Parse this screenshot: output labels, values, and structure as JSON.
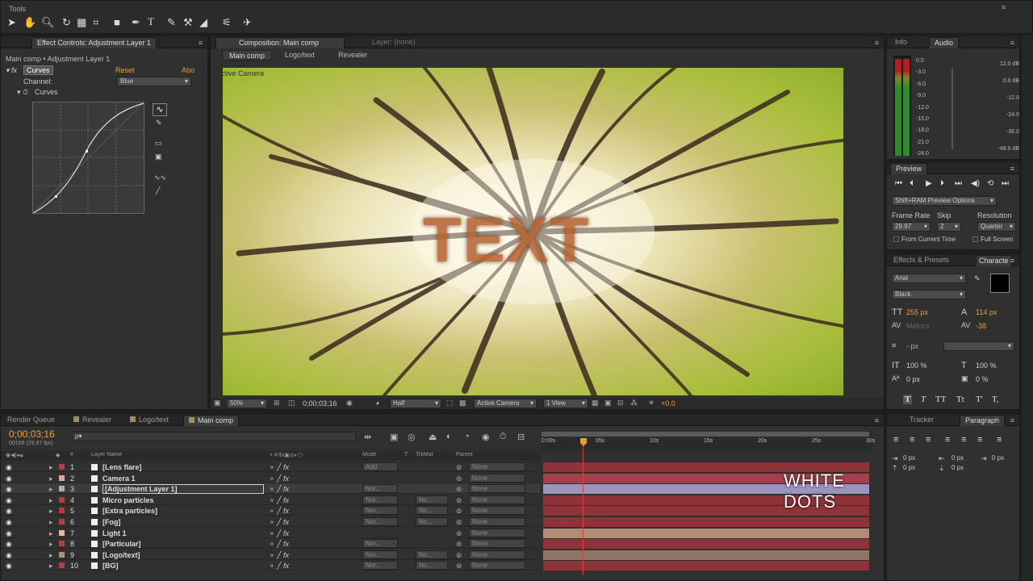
{
  "tools": {
    "title": "Tools"
  },
  "effect_controls": {
    "tab": "Effect Controls: Adjustment Layer 1",
    "breadcrumb": "Main comp • Adjustment Layer 1",
    "effect_name": "Curves",
    "reset": "Reset",
    "about": "Abo",
    "channel_label": "Channel:",
    "channel_value": "Blue",
    "curves_label": "Curves"
  },
  "composition": {
    "tab": "Composition: Main comp",
    "layer_tab": "Layer: (none)",
    "flow": [
      "Main comp",
      "Logo/text",
      "Revealer"
    ],
    "camera_label": "Active Camera",
    "text_overlay": "TEXT",
    "footer": {
      "zoom": "50%",
      "time": "0;00;03;16",
      "resolution": "Half",
      "camera": "Active Camera",
      "views": "1 View",
      "exposure": "+0.0"
    }
  },
  "info_audio": {
    "tab_info": "Info",
    "tab_audio": "Audio",
    "left_scale": [
      "0.0",
      "-3.0",
      "-6.0",
      "-9.0",
      "-12.0",
      "-15.0",
      "-18.0",
      "-21.0",
      "-24.0"
    ],
    "right_scale": [
      "12.0 dB",
      "0.0 dB",
      "-12.0",
      "-24.0",
      "-36.0",
      "-48.0 dB"
    ]
  },
  "preview": {
    "tab": "Preview",
    "ram_options": "Shift+RAM Preview Options",
    "frame_rate_label": "Frame Rate",
    "skip_label": "Skip",
    "resolution_label": "Resolution",
    "frame_rate": "29.97",
    "skip": "2",
    "resolution": "Quarter",
    "from_current": "From Current Time",
    "full_screen": "Full Screen"
  },
  "character": {
    "tab_effects": "Effects & Presets",
    "tab_character": "Characte",
    "font": "Arial",
    "style": "Black",
    "size": "255 px",
    "leading": "114 px",
    "kerning": "Metrics",
    "tracking": "-38",
    "stroke": "- px",
    "vscale": "100 %",
    "hscale": "100 %",
    "baseline": "0 px",
    "tsume": "0 %",
    "style_buttons": [
      "T",
      "T",
      "TT",
      "Tt",
      "T'",
      "T,"
    ]
  },
  "paragraph": {
    "tab_tracker": "Tracker",
    "tab_paragraph": "Paragraph",
    "indent_values": [
      "0 px",
      "0 px",
      "0 px",
      "0 px",
      "0 px"
    ]
  },
  "timeline": {
    "tabs": [
      "Render Queue",
      "Revealer",
      "Logo/text",
      "Main comp"
    ],
    "timecode": "0;00;03;16",
    "fps": "00106 (29.97 fps)",
    "search_placeholder": "ρ▾",
    "col_headers": {
      "layer_name": "Layer Name",
      "mode": "Mode",
      "t": "T",
      "trkmat": "TrkMat",
      "parent": "Parent"
    },
    "ruler": [
      "0:00s",
      "05s",
      "10s",
      "15s",
      "20s",
      "25s",
      "30s"
    ],
    "layers": [
      {
        "num": "1",
        "name": "[Lens flare]",
        "mode": "Add",
        "trk": "",
        "parent": "None",
        "color": "#c0383a",
        "bar": "#8e3439"
      },
      {
        "num": "2",
        "name": "Camera 1",
        "mode": "",
        "trk": "",
        "parent": "None",
        "color": "#e8a0a8",
        "bar": "#a1424a"
      },
      {
        "num": "3",
        "name": "[Adjustment Layer 1]",
        "mode": "Nor...",
        "trk": "",
        "parent": "None",
        "color": "#b8a8c8",
        "bar": "#9d93bf"
      },
      {
        "num": "4",
        "name": "Micro particles",
        "mode": "Nor...",
        "trk": "No...",
        "parent": "None",
        "color": "#c0383a",
        "bar": "#8e3439"
      },
      {
        "num": "5",
        "name": "[Extra particles]",
        "mode": "Nor...",
        "trk": "No...",
        "parent": "None",
        "color": "#c0383a",
        "bar": "#8e3439"
      },
      {
        "num": "6",
        "name": "[Fog]",
        "mode": "Nor...",
        "trk": "No...",
        "parent": "None",
        "color": "#c0383a",
        "bar": "#8e3439"
      },
      {
        "num": "7",
        "name": "Light 1",
        "mode": "",
        "trk": "",
        "parent": "None",
        "color": "#e8b89a",
        "bar": "#b28b75"
      },
      {
        "num": "8",
        "name": "[Particular]",
        "mode": "Nor...",
        "trk": "",
        "parent": "None",
        "color": "#c0383a",
        "bar": "#8e3439"
      },
      {
        "num": "9",
        "name": "[Logo/text]",
        "mode": "Nor...",
        "trk": "No...",
        "parent": "None",
        "color": "#b09070",
        "bar": "#8e7565"
      },
      {
        "num": "10",
        "name": "[BG]",
        "mode": "Nor...",
        "trk": "No...",
        "parent": "None",
        "color": "#c0383a",
        "bar": "#8e3439"
      }
    ],
    "overlay_caption": "WHITE DOTS"
  }
}
